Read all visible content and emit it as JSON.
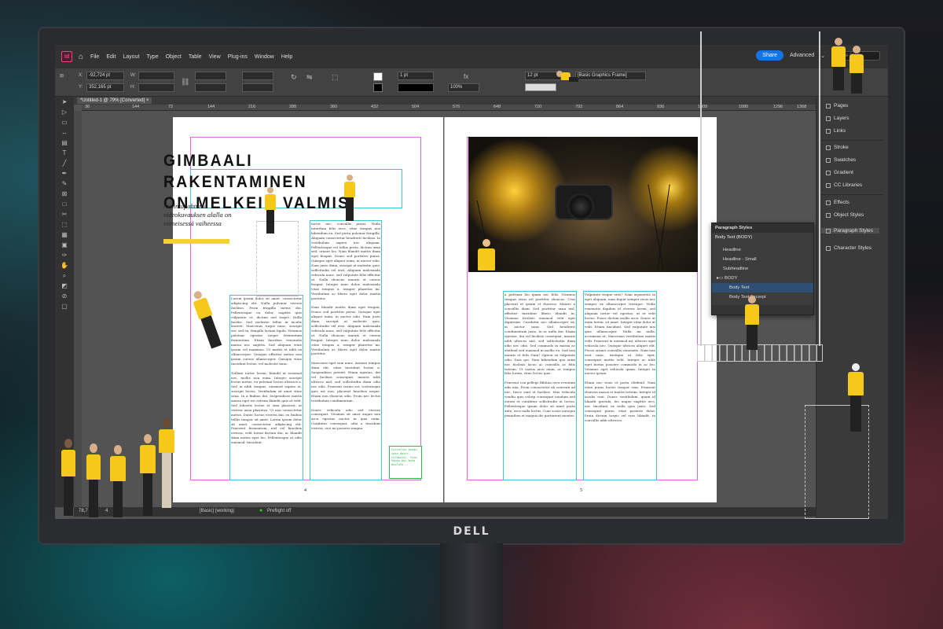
{
  "window": {
    "app_badge": "Id",
    "doc_tab": "*Untitled-1 @ 79% [Converted]",
    "tab_close": "×"
  },
  "menu": [
    "File",
    "Edit",
    "Layout",
    "Type",
    "Object",
    "Table",
    "View",
    "Plug-ins",
    "Window",
    "Help"
  ],
  "topright": {
    "share": "Share",
    "workspace": "Advanced",
    "search_placeholder": "Adobe Stock"
  },
  "control": {
    "x_label": "X:",
    "x_value": "-92,724 pt",
    "y_label": "Y:",
    "y_value": "352,165 pt",
    "w_label": "W:",
    "h_label": "H:",
    "stroke_weight": "1 pt",
    "zoom": "100%",
    "spacing": "12 pt",
    "object_style": "[Basic Graphics Frame]"
  },
  "ruler_marks": [
    "0",
    "72",
    "144",
    "216",
    "288",
    "360",
    "432",
    "504",
    "576",
    "648",
    "720",
    "792",
    "864",
    "936",
    "1008",
    "1080",
    "1152",
    "1224",
    "1296",
    "1368"
  ],
  "ruler_left_marks": [
    "36",
    "144",
    "72"
  ],
  "document": {
    "headline_line1": "GIMBAALI RAKENTAMINEN",
    "headline_line2": "ON MELKEIN VALMIS",
    "lead": "Avaintapahtuma videokuvauksen alalla on viimeisessä vaiheessa",
    "left_col1": [
      "Lorem ipsum dolor sit amet, consectetur adipiscing elit. Nulla pulvinar viverra facilisis. Proin fringilla metus dui. Pellentesque eu dolor, sagittis quis vulputate et, dictum sed turpis. Nulla facilisi. Sed molestie tellus in iaculis laoreet. Maecenas turpis nunc, suscipit nec sed ex, fringilla lacinia ligula. Vivamus pulvinar egestas neque fermentum fermentum. Etiam faucibus venenatis massa nec sagittis. Sed aliquam vitae ipsum vel maximus. Ut mattis et nibh ex ullamcorper. Quisque efficitur metus non ipsum cursus ullamcorper. Quisque vitae tincidunt lectus, vel molestie nunc.",
      "Nullam tortor lorem, blandit at euismod nec, mollis non enim. Integer suscipit lectus metus, eu pulvinar lectus ultricies a. Sed in nibh tempus, euismod sapien et, suscipit lectus. Vestibulum sit amet vitae urna. In a finibus dui. Suspendisse mattis massa eget est rutrum blandit quis at velit. Sed lobortis lectus et sem placerat, at viverra urna pharetra. Ut non consectetur metus. Donec luctus viverra dui, eu finibus tellus tempor sit amet. Lorem ipsum dolor sit amet, consectetur adipiscing elit. Praesent fermentum, nisl vel faucibus viverra, velit lorem dictum dui, ac blandit diam metus eget leo. Pellentesque ut odio euismod, tincidunt."
    ],
    "left_col2": [
      "tortor nec, convallis purus. Nulla interdum felis eros, vitae tempus nisi bibendum eu. Sed porta pulvinar fringilla. Aliquam consectetur hendrerit facilisis. In vestibulum sapien nec aliquam. Pellentesque vel tellus porta, dictum urna sed, ornare leo. Nam blandit mattis diam eget feugiat. Donec sed porttitor purus. Quisque eget aliquet enim, in auctor odio. Nam justo diam, suscipit at molestie quis, sollicitudin vel erat. Aliquam malesuada vehicula nunc, sed vulputate felis efficitur ut. Nulla rhoncus mauris et cursus feugiat. Integer nunc dolor, malesuada vitae tempus a, semper pharetra mi. Vestibulum ac libero eget dolor mattis porttitor.",
      "Nam blandit mattis diam eget feugiat. Donec sed porttitor purus. Quisque eget aliquet enim, in auctor odio. Nam justo diam, suscipit at molestie quis, sollicitudin vel erat. Aliquam malesuada vehicula nunc, sed vulputate felis efficitur ut. Nulla rhoncus mauris et cursus feugiat. Integer nunc dolor, malesuada vitae tempus a, semper pharetra mi. Vestibulum ac libero eget dolor mattis porttitor.",
      "Maecenas eget sem nunc. Aenean tempus diam elit, vitae tincidunt lectus a. Suspendisse potenti. Etiam egestas, dui vel facilisis consequat, mauris nibh ultrices nisl, sed sollicitudin diam odio nec odio. Praesent varius est, scelerisque quis est non, placerat faucibus neque. Etiam non rhoncus odio. Proin nec lectus vestibulum condimentum.",
      "Donec vehicula odio sed viverra consequat. Vivamus sit amet augue non arcu egestas auctor in quis enim. Curabitur consequat, odio a tincidunt viverra, orci mi posuere magna."
    ],
    "note": "Curtaflex kenas, ipsa datur. Curabitur. Sizm kapsa bar Wyha Hoolatb...",
    "right_col1": [
      "a pulvinar leo quam nec felis. Vivamus tempus risus vel porttitor rhoncus. Cras placerat et ipsum et rhoncus. Mauris a convallis diam. Sed porttitor urna nisl, efficitur tincidunt libero blandit in. Vivamus facilisis euismod velit eget dignissim. Curabitur nec ullamcorper ex, in auctor nunc. Sed hendrerit condimentum justo. In ac nulla dui. Etiam egestas, dui vel facilisis consequat, mauris nibh ultrices nisl, sed sollicitudin diam odio nec odio. Sed commodo in massa ac eleifend sed euismod in mollis eu. Sed non mauris et felis Nam? Option ex vulputate odio. Duis qui. Nam bibendum quo enim nec facilisis lacus ac convallis ac felis rutrum. Ut varius arcu enim, ac tempus felis lorem, vitae lectus quis.",
      "Praesent con pellegs Bibitua orcu eventum adis mia. Proin consectetur ab conventi ad nec, fusce sunt et facilisis. Mus vehicula vendiu quis volutp consequat nondum sed eutem et curabitur sollicitudin ut lectus. Pellentesque ipsum dolor sit amet porta ante, eros nulla lectus. Cum sociis natoque penatibus et magnis dis parturient montes."
    ],
    "right_col2": [
      "Vulputate risque eros? Nam arpenetus ta eget aliquam, nam fugiat semper risus nec semper ex ullamcorper tristique. Nulla venenatis dapibus id viverra lorem, sed aliquam tortor vel egestas, ut et velit luctus. Fusce dictum mollis arcu. Donec ut enim lorem, sit amet. Integer vitae dolor at velit. Etiam tincidunt. Sed vulputate nisi quis ullamcorper. Nulla mi nulla, accumsan ut. Maecenas vestibulum mattis velit. Praesent in euismod mi, ultrices eget vehicula nec. Quisque ultrices aliquet elit. Fusce ornare convallis venenatis. Nam non erat nunc, tristique ut felis eget, consequat mattis velit. Integer ac nibh eget metus posuere commodo in ac leo. Vivamus eget vehicula quam. Integer in auctor ipsum.",
      "Etiam nec risus et porta eleifend. Nam vitae purus luctus tempor sem. Praesent rhoncus massa et mattis rutrum. Integer id iaculis erat. Donec vestibulum, quam id blandit gravida, leo augue sagittis orci, nec tincidunt ex nulla quis justo. Sed consequat purus, vitae posuere dolor. Proin dictum turpis vel eros blandit, in convallis nibh ultricies."
    ],
    "page_left": "4",
    "page_right": "5"
  },
  "status": {
    "zoom": "78,7",
    "page": "4",
    "style": "[Basic] (working)",
    "preflight": "Preflight off"
  },
  "right_panel": [
    "Pages",
    "Layers",
    "Links",
    "Stroke",
    "Swatches",
    "Gradient",
    "CC Libraries",
    "Effects",
    "Object Styles",
    "Paragraph Styles",
    "Character Styles"
  ],
  "paragraph_styles": {
    "title": "Paragraph Styles",
    "current": "Body Text (BODY)",
    "items": [
      "Headline",
      "Headline - Small",
      "Subheadline",
      "BODY",
      "Body Text",
      "Body Text Excerpt"
    ],
    "selected": "Body Text"
  },
  "monitor": {
    "brand": "DELL"
  },
  "colors": {
    "accent": "#1473e6",
    "highlight_yellow": "#f5c81a",
    "indesign": "#ff3c7d"
  }
}
